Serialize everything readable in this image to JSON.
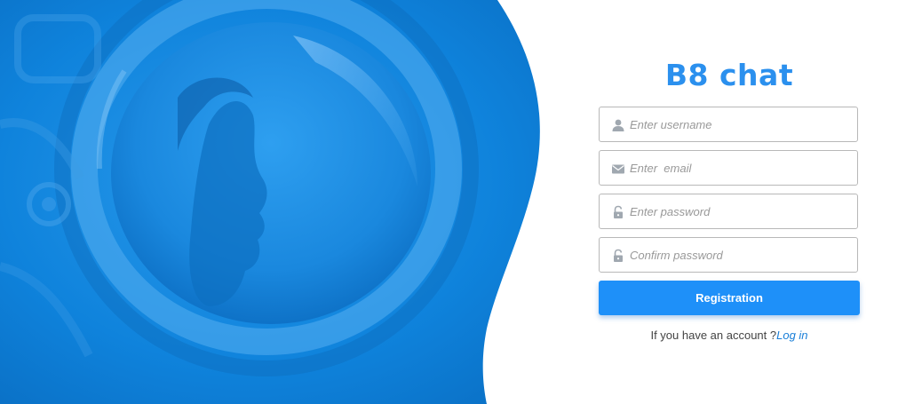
{
  "app": {
    "title": "B8 chat"
  },
  "form": {
    "username": {
      "placeholder": "Enter username",
      "icon": "user-icon"
    },
    "email": {
      "placeholder": "Enter  email",
      "icon": "envelope-icon"
    },
    "password": {
      "placeholder": "Enter password",
      "icon": "lock-icon"
    },
    "confirm_password": {
      "placeholder": "Confirm password",
      "icon": "lock-icon"
    },
    "submit_label": "Registration"
  },
  "footer": {
    "prompt": "If you have an account ?",
    "login_link": "Log in"
  },
  "colors": {
    "brand": "#2b90ee",
    "button": "#1e90f9",
    "link": "#1a7fd8",
    "hero": "#0a86e0"
  }
}
